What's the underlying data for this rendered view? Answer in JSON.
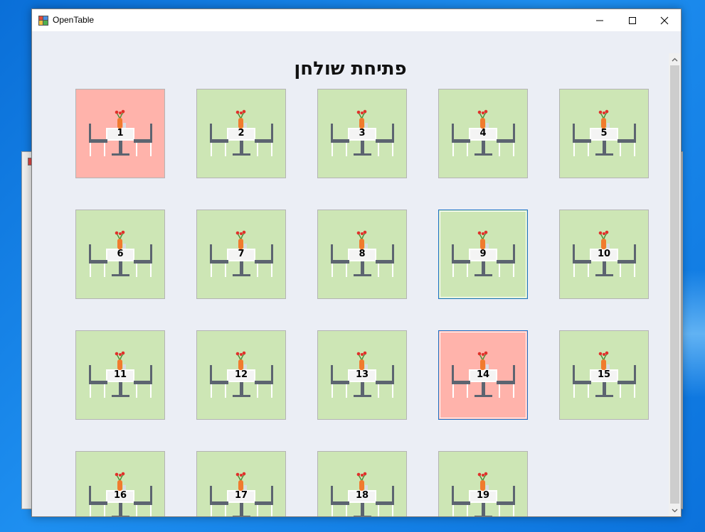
{
  "window": {
    "title": "OpenTable",
    "controls": {
      "minimize": "—",
      "maximize": "☐",
      "close": "✕"
    }
  },
  "heading": "פתיחת שולחן",
  "colors": {
    "free": "#cde6b5",
    "occupied": "#ffb3ab",
    "focus_border": "#1e73c9"
  },
  "tables": [
    {
      "number": "1",
      "status": "occupied"
    },
    {
      "number": "2",
      "status": "free"
    },
    {
      "number": "3",
      "status": "free"
    },
    {
      "number": "4",
      "status": "free"
    },
    {
      "number": "5",
      "status": "free"
    },
    {
      "number": "6",
      "status": "free"
    },
    {
      "number": "7",
      "status": "free"
    },
    {
      "number": "8",
      "status": "free"
    },
    {
      "number": "9",
      "status": "free",
      "focused": true
    },
    {
      "number": "10",
      "status": "free"
    },
    {
      "number": "11",
      "status": "free"
    },
    {
      "number": "12",
      "status": "free"
    },
    {
      "number": "13",
      "status": "free"
    },
    {
      "number": "14",
      "status": "occupied",
      "focused": true
    },
    {
      "number": "15",
      "status": "free"
    },
    {
      "number": "16",
      "status": "free"
    },
    {
      "number": "17",
      "status": "free"
    },
    {
      "number": "18",
      "status": "free"
    },
    {
      "number": "19",
      "status": "free"
    }
  ],
  "icons": {
    "table_icon": "dining-table-icon",
    "app_icon": "windows-form-icon"
  }
}
